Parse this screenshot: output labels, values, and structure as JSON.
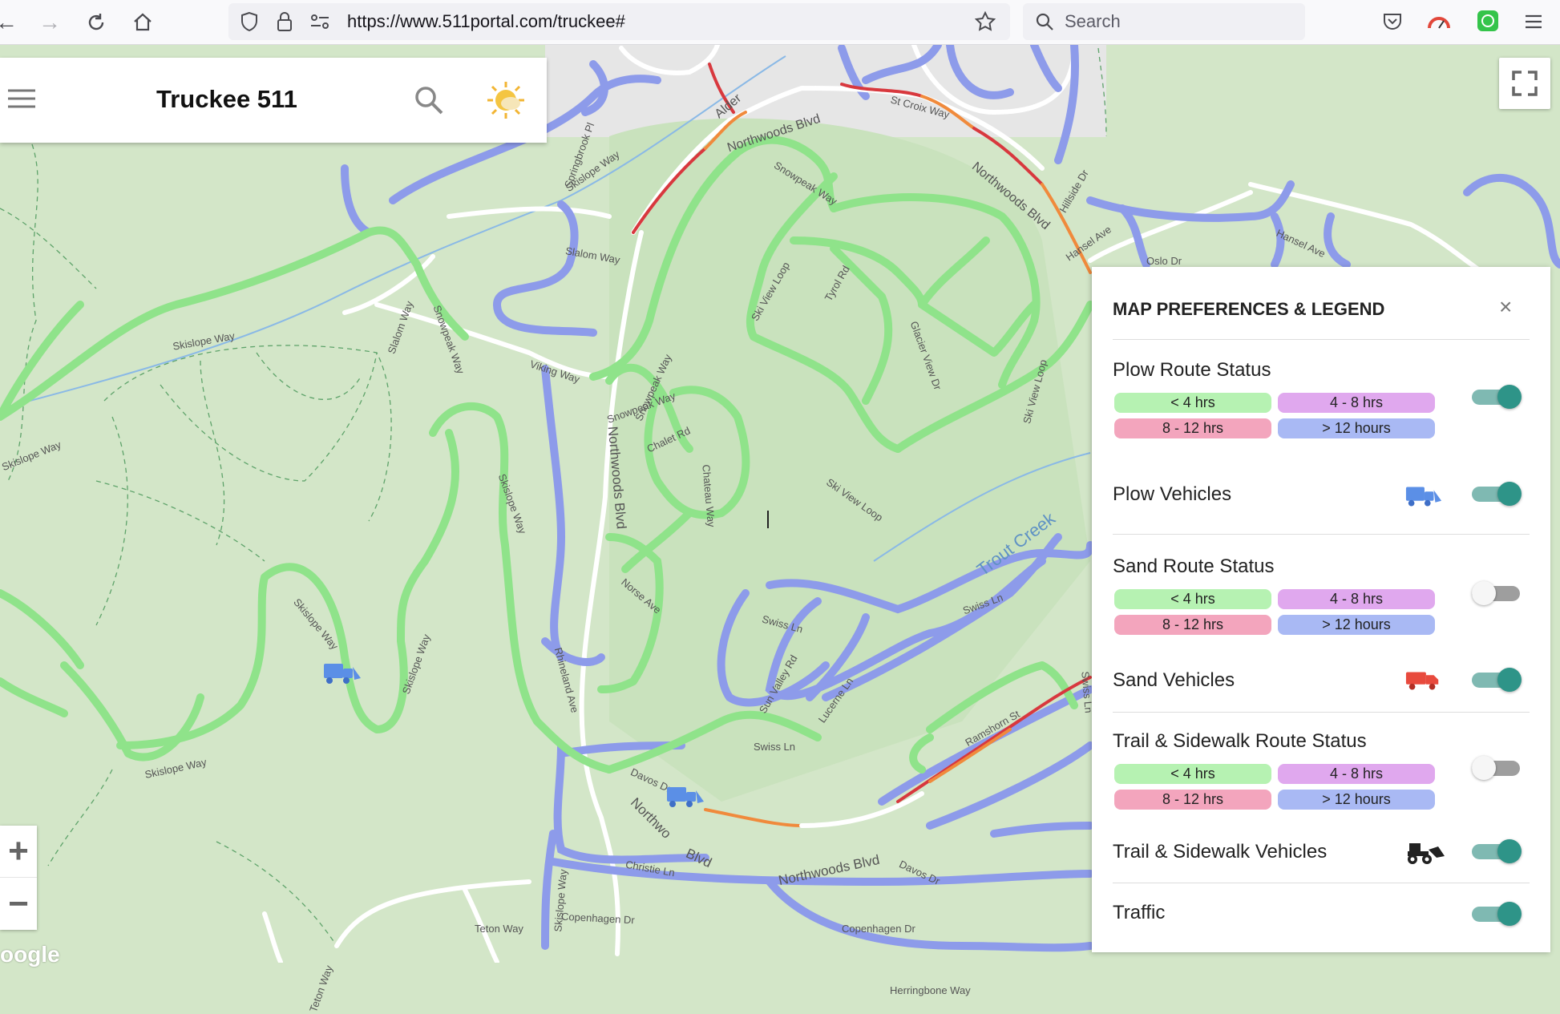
{
  "browser": {
    "url": "https://www.511portal.com/truckee#",
    "search_placeholder": "Search"
  },
  "header": {
    "title": "Truckee 511"
  },
  "map": {
    "labels": {
      "northwoods_blvd_1": "Northwoods Blvd",
      "northwoods_blvd_2": "Northwoods Blvd",
      "northwoods_blvd_3": "Northwoods Blvd",
      "northwoods_blvd_4": "Northwoods Blvd",
      "northwoods_blvd_5": "Northwo",
      "snowpeak_way_1": "Snowpeak Way",
      "snowpeak_way_2": "Snowpeak Way",
      "snowpeak_way_3": "Snowpeak Way",
      "snowpeak_way_4": "Snowpeak Way",
      "skislope_way_1": "Skislope Way",
      "skislope_way_2": "Skislope Way",
      "skislope_way_3": "Skislope Way",
      "skislope_way_4": "Skislope Way",
      "skislope_way_5": "Skislope Way",
      "skislope_way_6": "Skislope Way",
      "skislope_way_7": "Skislope Way",
      "skislope_way_8": "Skislope Way",
      "slalom_way_1": "Slalom Way",
      "slalom_way_2": "Slalom Way",
      "viking_way": "Viking Way",
      "springbrook_pl": "Springbrook Pl",
      "alder": "Alder",
      "hillside_dr": "Hillside Dr",
      "st_croix_way": "St Croix Way",
      "hansel_ave_1": "Hansel Ave",
      "hansel_ave_2": "Hansel Ave",
      "oslo_dr": "Oslo Dr",
      "ski_view_loop_1": "Ski View Loop",
      "ski_view_loop_2": "Ski View Loop",
      "ski_view_loop_3": "Ski View Loop",
      "tyrol_rd": "Tyrol Rd",
      "glacier_view_dr": "Glacier View Dr",
      "chalet_rd": "Chalet Rd",
      "chateau_way": "Chateau Way",
      "norse_ave": "Norse Ave",
      "rhineland_ave": "Rhineland Ave",
      "swiss_ln_1": "Swiss Ln",
      "swiss_ln_2": "Swiss Ln",
      "swiss_ln_3": "Swiss Ln",
      "swiss_ln_4": "Swiss Ln",
      "sun_valley_rd": "Sun Valley Rd",
      "lucerne_ln": "Lucerne Ln",
      "ramshorn_st": "Ramshorn St",
      "davos_dr_1": "Davos Dr",
      "davos_dr_2": "Davos Dr",
      "christie_ln": "Christie Ln",
      "copenhagen_dr_1": "Copenhagen Dr",
      "copenhagen_dr_2": "Copenhagen Dr",
      "teton_way_1": "Teton Way",
      "teton_way_2": "Teton Way",
      "herringbone_way": "Herringbone Way",
      "trout_creek": "Trout Creek"
    },
    "google_logo": "oogle",
    "zoom_in": "+",
    "zoom_out": "−"
  },
  "legend": {
    "title": "MAP PREFERENCES & LEGEND",
    "close": "×",
    "sections": [
      {
        "title": "Plow Route Status",
        "toggle_on": true,
        "pills": [
          "< 4 hrs",
          "4 - 8 hrs",
          "8 - 12 hrs",
          "> 12 hours"
        ]
      },
      {
        "title": "Plow Vehicles",
        "toggle_on": true,
        "icon": "plow-truck-icon"
      },
      {
        "title": "Sand Route Status",
        "toggle_on": false,
        "pills": [
          "< 4 hrs",
          "4 - 8 hrs",
          "8 - 12 hrs",
          "> 12 hours"
        ]
      },
      {
        "title": "Sand Vehicles",
        "toggle_on": true,
        "icon": "sand-truck-icon"
      },
      {
        "title": "Trail & Sidewalk Route Status",
        "toggle_on": false,
        "pills": [
          "< 4 hrs",
          "4 - 8 hrs",
          "8 - 12 hrs",
          "> 12 hours"
        ]
      },
      {
        "title": "Trail & Sidewalk Vehicles",
        "toggle_on": true,
        "icon": "loader-icon"
      },
      {
        "title": "Traffic",
        "toggle_on": true
      }
    ],
    "pill_colors": {
      "lt4": "#b6f2b2",
      "4to8": "#e0a8ee",
      "8to12": "#f3a5bd",
      "gt12": "#a9b9f4"
    }
  },
  "colors": {
    "route_green": "#8fe38a",
    "route_blue": "#8d9bea",
    "route_red": "#d8383e",
    "route_orange": "#f08a3c",
    "toggle_on": "#2e9488"
  }
}
